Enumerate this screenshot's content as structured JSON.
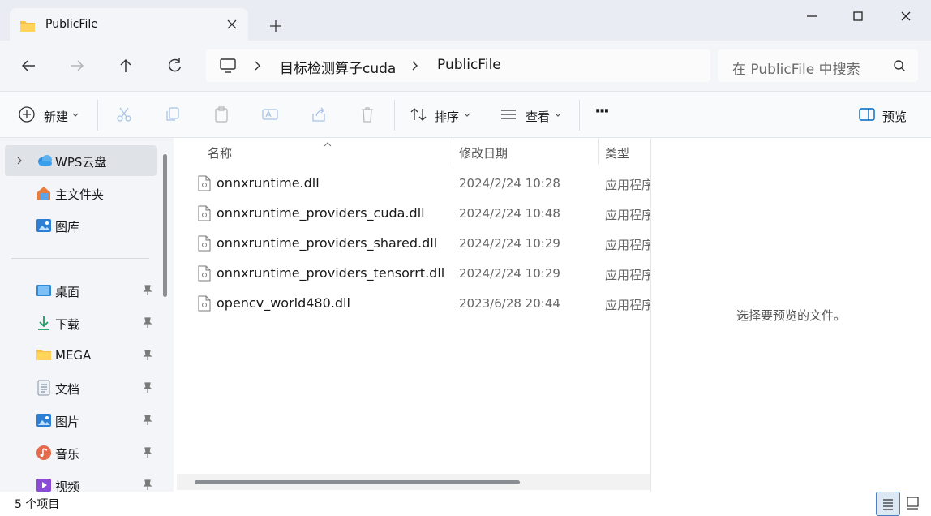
{
  "tab": {
    "title": "PublicFile",
    "icon": "folder-icon"
  },
  "address": {
    "segments": [
      "目标检测算子cuda",
      "PublicFile"
    ],
    "search_placeholder": "在 PublicFile 中搜索"
  },
  "toolbar": {
    "new_label": "新建",
    "sort_label": "排序",
    "view_label": "查看",
    "more_label": "···",
    "preview_label": "预览"
  },
  "sidebar": {
    "items": [
      {
        "label": "WPS云盘",
        "icon": "cloud-icon"
      },
      {
        "label": "主文件夹",
        "icon": "home-icon"
      },
      {
        "label": "图库",
        "icon": "gallery-icon"
      },
      {
        "label": "桌面",
        "icon": "desktop-icon"
      },
      {
        "label": "下载",
        "icon": "download-icon"
      },
      {
        "label": "MEGA",
        "icon": "folder-icon"
      },
      {
        "label": "文档",
        "icon": "document-icon"
      },
      {
        "label": "图片",
        "icon": "pictures-icon"
      },
      {
        "label": "音乐",
        "icon": "music-icon"
      },
      {
        "label": "视频",
        "icon": "video-icon"
      }
    ]
  },
  "filelist": {
    "columns": {
      "name": "名称",
      "modified": "修改日期",
      "type": "类型"
    },
    "rows": [
      {
        "name": "onnxruntime.dll",
        "modified": "2024/2/24 10:28",
        "type": "应用程序扩展"
      },
      {
        "name": "onnxruntime_providers_cuda.dll",
        "modified": "2024/2/24 10:48",
        "type": "应用程序扩展"
      },
      {
        "name": "onnxruntime_providers_shared.dll",
        "modified": "2024/2/24 10:29",
        "type": "应用程序扩展"
      },
      {
        "name": "onnxruntime_providers_tensorrt.dll",
        "modified": "2024/2/24 10:29",
        "type": "应用程序扩展"
      },
      {
        "name": "opencv_world480.dll",
        "modified": "2023/6/28 20:44",
        "type": "应用程序扩展"
      }
    ]
  },
  "preview": {
    "empty_text": "选择要预览的文件。"
  },
  "status": {
    "item_count": "5 个项目"
  },
  "colors": {
    "accent": "#0067c0",
    "folder": "#f4c344"
  }
}
